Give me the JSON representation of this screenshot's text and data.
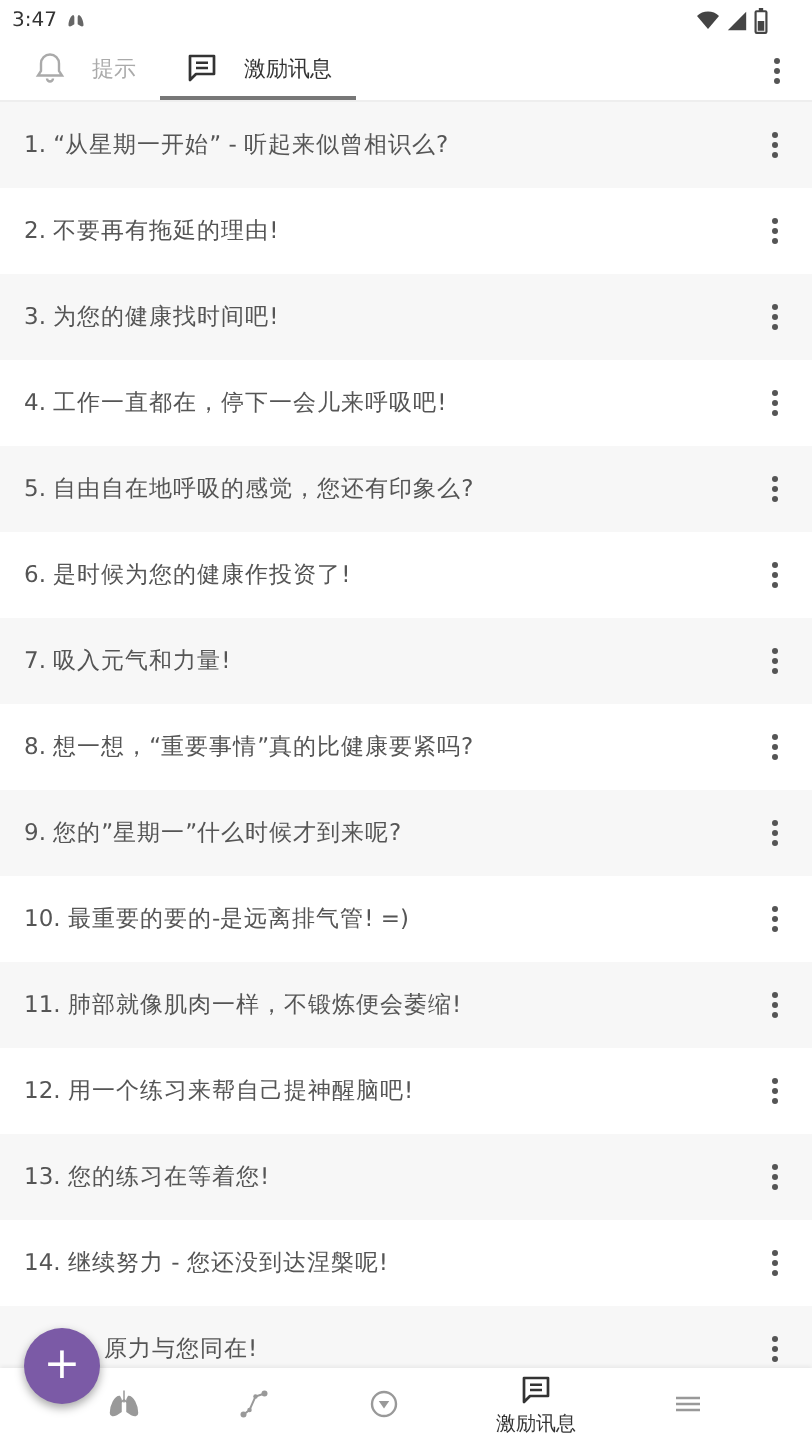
{
  "status_bar": {
    "time": "3:47"
  },
  "tabs": [
    {
      "label": "提示",
      "selected": false
    },
    {
      "label": "激励讯息",
      "selected": true
    }
  ],
  "messages": [
    {
      "number": "1.",
      "text": "“从星期一开始” - 听起来似曾相识么?"
    },
    {
      "number": "2.",
      "text": "不要再有拖延的理由!"
    },
    {
      "number": "3.",
      "text": "为您的健康找时间吧!"
    },
    {
      "number": "4.",
      "text": "工作一直都在，停下一会儿来呼吸吧!"
    },
    {
      "number": "5.",
      "text": "自由自在地呼吸的感觉，您还有印象么?"
    },
    {
      "number": "6.",
      "text": "是时候为您的健康作投资了!"
    },
    {
      "number": "7.",
      "text": "吸入元气和力量!"
    },
    {
      "number": "8.",
      "text": "想一想，“重要事情”真的比健康要紧吗?"
    },
    {
      "number": "9.",
      "text": "您的”星期一”什么时候才到来呢?"
    },
    {
      "number": "10.",
      "text": "最重要的要的-是远离排气管! =)"
    },
    {
      "number": "11.",
      "text": "肺部就像肌肉一样，不锻炼便会萎缩!"
    },
    {
      "number": "12.",
      "text": "用一个练习来帮自己提神醒脑吧!"
    },
    {
      "number": "13.",
      "text": "您的练习在等着您!"
    },
    {
      "number": "14.",
      "text": "继续努力 - 您还没到达涅槃呢!"
    },
    {
      "text": "原力与您同在!"
    }
  ],
  "fab": {
    "label": "+"
  },
  "bottom_nav": [
    {
      "selected": false
    },
    {
      "selected": false
    },
    {
      "selected": false
    },
    {
      "label": "激励讯息",
      "selected": true
    },
    {
      "selected": false
    }
  ]
}
